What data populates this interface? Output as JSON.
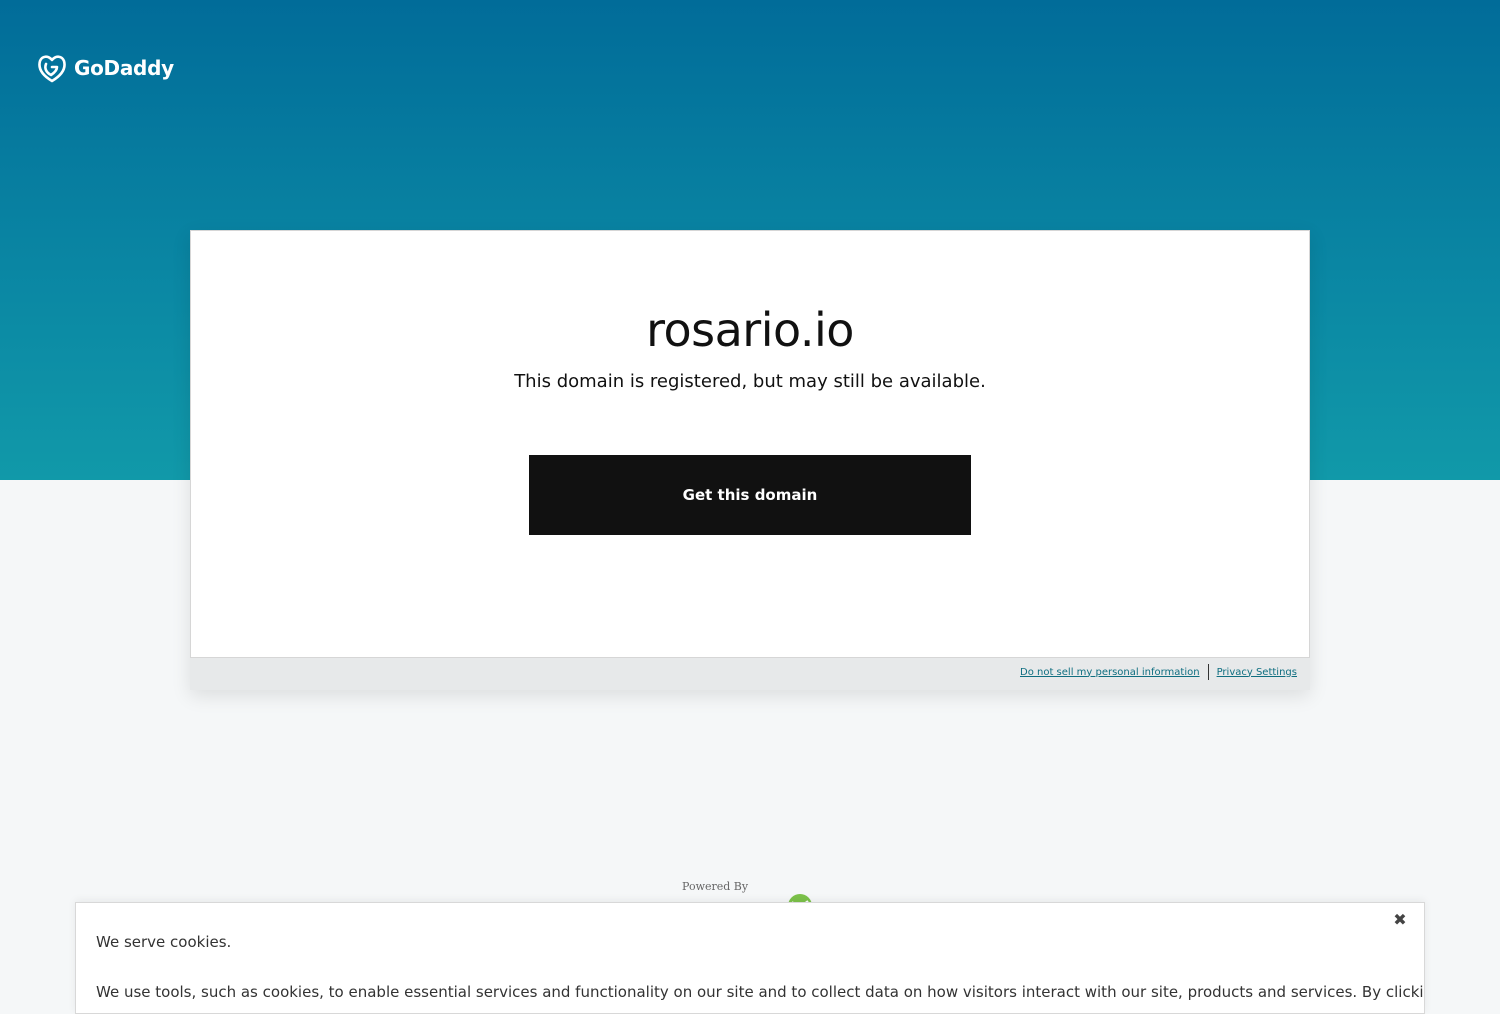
{
  "brand": {
    "name": "GoDaddy",
    "logo_icon": "godaddy-logo-icon"
  },
  "hero": {
    "gradient_top": "#016c99",
    "gradient_bottom": "#1199a9"
  },
  "card": {
    "domain": "rosario.io",
    "subtitle": "This domain is registered, but may still be available.",
    "cta_label": "Get this domain",
    "cta_color": "#111111"
  },
  "footer": {
    "do_not_sell": "Do not sell my personal information",
    "privacy_settings": "Privacy Settings",
    "link_color": "#0f6e80"
  },
  "powered": {
    "label": "Powered By"
  },
  "cookies": {
    "title": "We serve cookies.",
    "body": "We use tools, such as cookies, to enable essential services and functionality on our site and to collect data on how visitors interact with our site, products and services. By clicking",
    "close_icon": "close-icon",
    "close_glyph": "✖"
  }
}
